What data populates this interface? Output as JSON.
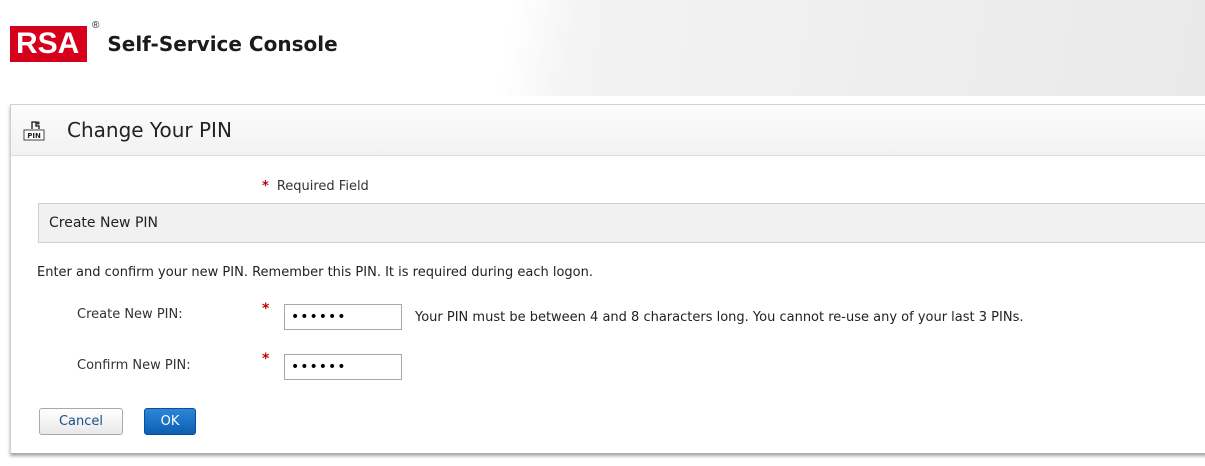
{
  "brand": {
    "logo_text": "RSA",
    "registered_mark": "®",
    "console_title": "Self-Service Console"
  },
  "page": {
    "title": "Change Your PIN",
    "icon": "pin-icon"
  },
  "form": {
    "required_star": "*",
    "required_note": "Required Field",
    "section_title": "Create New PIN",
    "instructions": "Enter and confirm your new PIN. Remember this PIN. It is required during each logon.",
    "create_pin_label": "Create New PIN:",
    "create_pin_value": "••••••",
    "pin_hint": "Your PIN must be between 4 and 8 characters long. You cannot re-use any of your last 3 PINs.",
    "confirm_pin_label": "Confirm New PIN:",
    "confirm_pin_value": "••••••"
  },
  "buttons": {
    "cancel_label": "Cancel",
    "ok_label": "OK"
  },
  "colors": {
    "brand_red": "#d6001c",
    "required_red": "#c00000",
    "primary_button": "#0c5fb1"
  }
}
